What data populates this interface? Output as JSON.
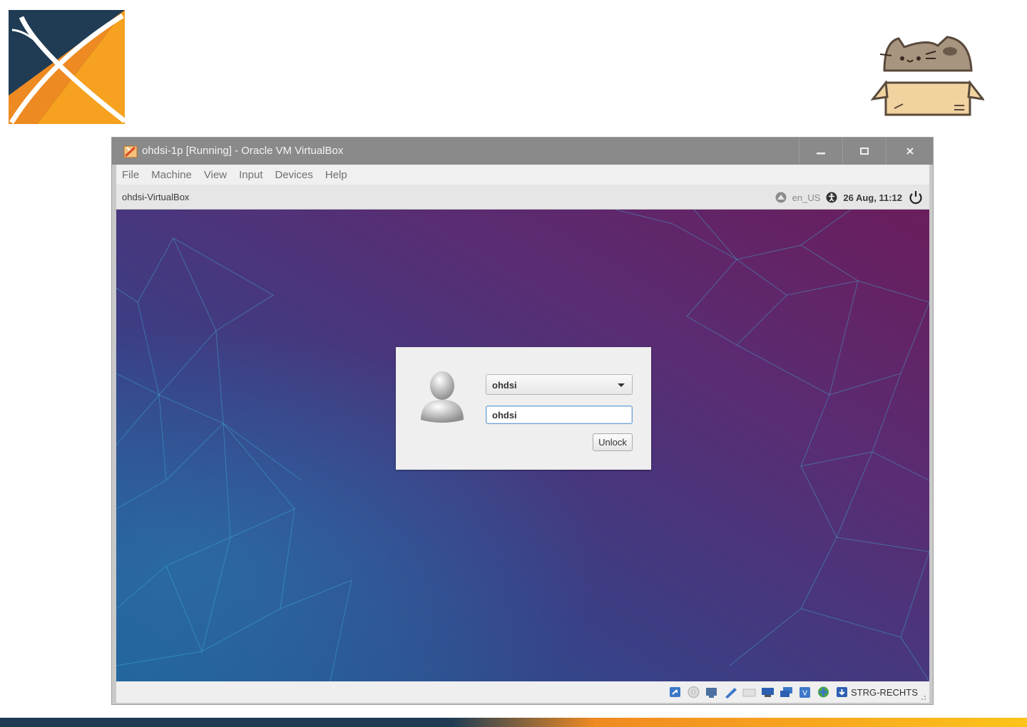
{
  "window": {
    "title": "ohdsi-1p [Running] - Oracle VM VirtualBox",
    "minimize_icon": "minimize-icon",
    "maximize_icon": "maximize-icon",
    "close_icon": "close-icon"
  },
  "menu": {
    "items": [
      "File",
      "Machine",
      "View",
      "Input",
      "Devices",
      "Help"
    ]
  },
  "panel": {
    "hostname": "ohdsi-VirtualBox",
    "language": "en_US",
    "datetime": "26 Aug, 11:12"
  },
  "lock": {
    "username": "ohdsi",
    "password_value": "ohdsi",
    "unlock_label": "Unlock"
  },
  "statusbar": {
    "host_key": "STRG-RECHTS",
    "icons": [
      "hard-disk-icon",
      "optical-drive-icon",
      "audio-icon",
      "pen-icon",
      "usb-icon",
      "shared-folders-icon",
      "display-icon",
      "clipboard-icon",
      "cpu-icon",
      "network-icon",
      "mouse-capture-icon"
    ]
  },
  "colors": {
    "desktop_purple": "#5b2c70",
    "desktop_blue": "#2b5c95",
    "accent_orange": "#f08a22",
    "navy": "#1f3c54"
  }
}
